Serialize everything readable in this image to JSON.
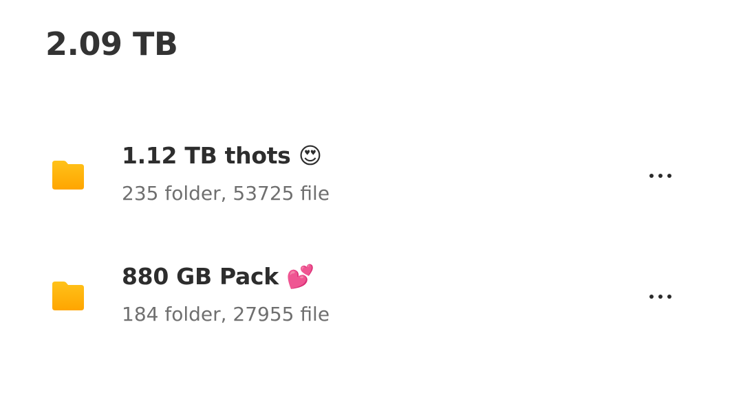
{
  "header": {
    "total_size": "2.09 TB"
  },
  "folders": [
    {
      "name": "1.12 TB thots 😍",
      "meta": "235 folder, 53725 file",
      "icon": "folder-icon",
      "menu_icon": "more-horizontal-icon"
    },
    {
      "name": "880 GB Pack 💕",
      "meta": "184 folder, 27955 file",
      "icon": "folder-icon",
      "menu_icon": "more-horizontal-icon"
    }
  ],
  "colors": {
    "folder_top": "#FFC21A",
    "folder_bottom": "#FFA500",
    "title_text": "#333333",
    "meta_text": "#6F6F6F"
  }
}
